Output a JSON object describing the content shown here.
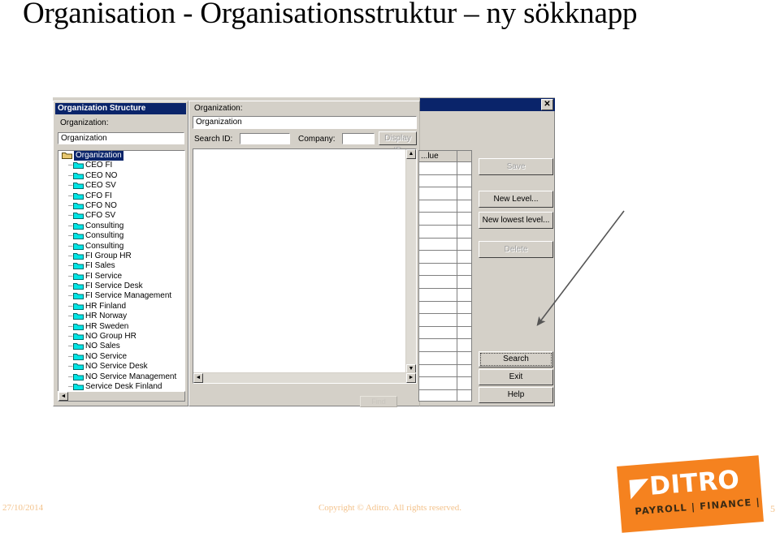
{
  "slide": {
    "title": "Organisation - Organisationsstruktur – ny sökknapp"
  },
  "window": {
    "close_icon": "✕"
  },
  "left_panel": {
    "header": "Organization Structure",
    "org_label": "Organization:",
    "org_value": "Organization",
    "hscroll_left_icon": "◄",
    "tree": {
      "root": {
        "label": "Organization",
        "selected": true,
        "icon": "open-folder-icon"
      },
      "items": [
        "CEO FI",
        "CEO NO",
        "CEO SV",
        "CFO FI",
        "CFO NO",
        "CFO SV",
        "Consulting",
        "Consulting",
        "Consulting",
        "FI Group HR",
        "FI Sales",
        "FI Service",
        "FI Service Desk",
        "FI Service Management",
        "HR Finland",
        "HR Norway",
        "HR Sweden",
        "NO Group HR",
        "NO Sales",
        "NO Service",
        "NO Service Desk",
        "NO Service Management",
        "Service Desk Finland"
      ]
    }
  },
  "mid_panel": {
    "org_label": "Organization:",
    "org_value": "Organization",
    "search_id_label": "Search ID:",
    "search_id_value": "",
    "search_id_placeholder": "",
    "company_label": "Company:",
    "company_value": "",
    "company_placeholder": "",
    "display_id_button": "Display ID",
    "scroll_up_icon": "▲",
    "scroll_down_icon": "▼",
    "scroll_left_icon": "◄",
    "scroll_right_icon": "►",
    "bottom_button_label": "Find"
  },
  "right_panel": {
    "grid_header": "...lue",
    "grid_row_count": 19,
    "buttons": {
      "save": "Save",
      "new_level": "New Level...",
      "new_lowest_level": "New lowest level...",
      "delete": "Delete",
      "search": "Search",
      "exit": "Exit",
      "help": "Help"
    }
  },
  "footer": {
    "date": "27/10/2014",
    "copyright": "Copyright © Aditro. All rights reserved.",
    "page_number": "5"
  },
  "logo": {
    "wordmark": "◤DITRO",
    "tagline": "PAYROLL  |  FINANCE  |  HR",
    "color": "#f5821f"
  },
  "colors": {
    "titlebar": "#0a246a",
    "dialog_face": "#d4d0c8",
    "folder_child": "#00e5e5",
    "folder_root": "#e8c870",
    "footer_text": "#f3c28b"
  }
}
